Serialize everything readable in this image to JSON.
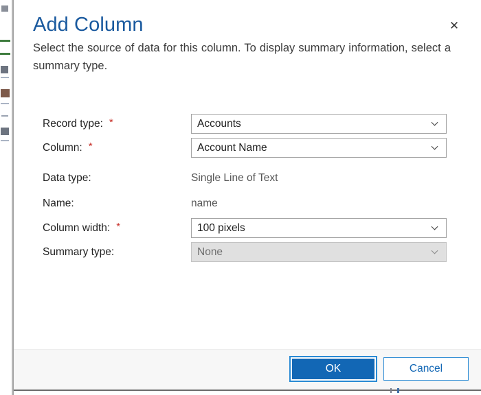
{
  "dialog": {
    "title": "Add Column",
    "description": "Select the source of data for this column. To display summary information, select a summary type.",
    "close_label": "✕"
  },
  "form": {
    "fields": [
      {
        "label": "Record type:",
        "required": true,
        "required_marker": "*",
        "control": "dropdown",
        "value": "Accounts",
        "disabled": false
      },
      {
        "label": "Column:",
        "required": true,
        "required_marker": "*",
        "control": "dropdown",
        "value": "Account Name",
        "disabled": false
      },
      {
        "label": "Data type:",
        "required": false,
        "required_marker": "",
        "control": "text",
        "value": "Single Line of Text",
        "disabled": false
      },
      {
        "label": "Name:",
        "required": false,
        "required_marker": "",
        "control": "text",
        "value": "name",
        "disabled": false
      },
      {
        "label": "Column width:",
        "required": true,
        "required_marker": "*",
        "control": "dropdown",
        "value": "100 pixels",
        "disabled": false
      },
      {
        "label": "Summary type:",
        "required": false,
        "required_marker": "",
        "control": "dropdown",
        "value": "None",
        "disabled": true
      }
    ]
  },
  "footer": {
    "ok_label": "OK",
    "cancel_label": "Cancel"
  },
  "colors": {
    "title_blue": "#19599e",
    "accent_blue": "#1267b5",
    "focus_ring": "#2a8ad4",
    "required_red": "#c8322b",
    "footer_bg": "#f7f7f7",
    "disabled_bg": "#e0e0e0"
  }
}
